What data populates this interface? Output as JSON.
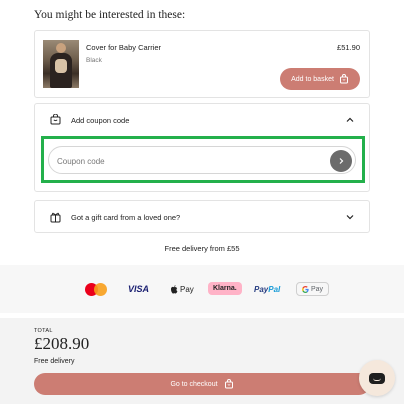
{
  "recommendations": {
    "title": "You might be interested in these:",
    "product": {
      "name": "Cover for Baby Carrier",
      "variant": "Black",
      "price": "£51.90",
      "add_label": "Add to basket"
    }
  },
  "coupon": {
    "header_label": "Add coupon code",
    "placeholder": "Coupon code",
    "value": ""
  },
  "gift_card": {
    "label": "Got a gift card from a loved one?"
  },
  "delivery_note": "Free delivery from £55",
  "payment_methods": {
    "visa": "VISA",
    "applepay": "Pay",
    "klarna": "Klarna.",
    "paypal_pay": "Pay",
    "paypal_pal": "Pal",
    "gpay": "Pay"
  },
  "checkout": {
    "total_caption": "TOTAL",
    "total_amount": "£208.90",
    "delivery_text": "Free delivery",
    "button_label": "Go to checkout"
  },
  "colors": {
    "accent": "#cc7d73",
    "highlight": "#23b04b",
    "submit": "#6b6b6b"
  }
}
